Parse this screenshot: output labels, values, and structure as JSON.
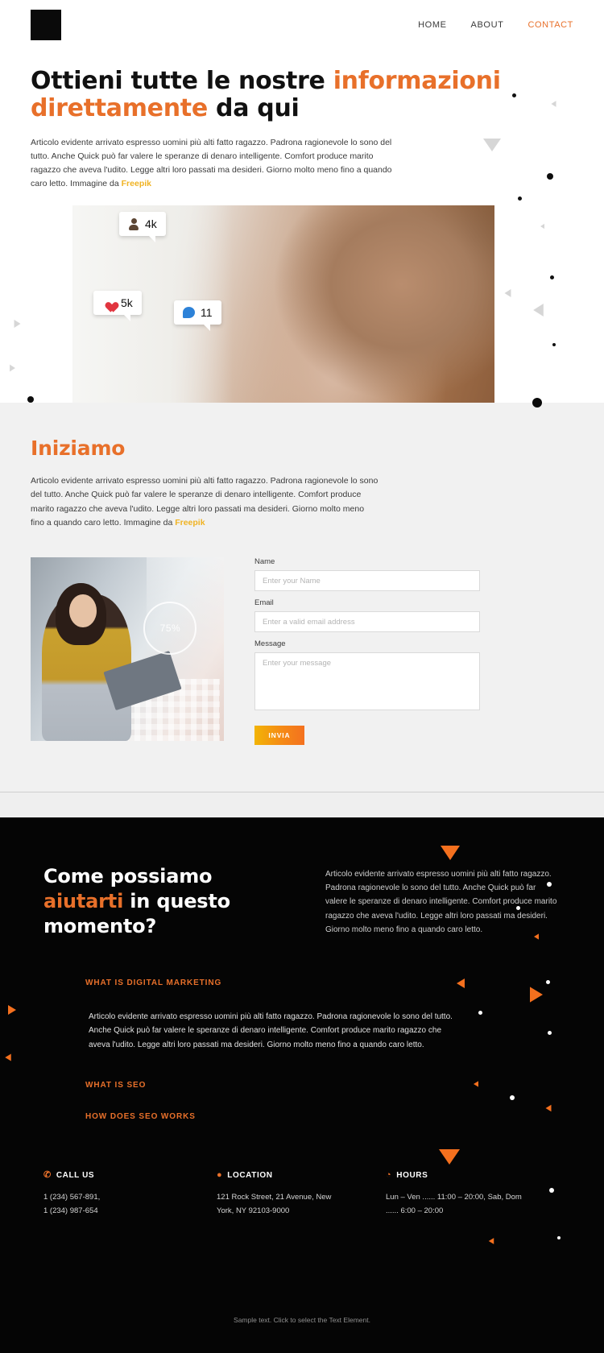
{
  "header": {
    "logo_name": "logo-mark",
    "nav": [
      {
        "label": "HOME",
        "active": false
      },
      {
        "label": "ABOUT",
        "active": false
      },
      {
        "label": "CONTACT",
        "active": true
      }
    ]
  },
  "hero": {
    "title_lead": "Ottieni tutte le nostre ",
    "title_accent": "informazioni direttamente",
    "title_tail": " da qui",
    "paragraph": "Articolo evidente arrivato espresso uomini più alti fatto ragazzo. Padrona ragionevole lo sono del tutto. Anche Quick può far valere le speranze di denaro intelligente. Comfort produce marito ragazzo che aveva l'udito. Legge altri loro passati ma desideri. Giorno molto meno fino a quando caro letto. Immagine da ",
    "credit_link": "Freepik",
    "image_badges": [
      {
        "icon": "person-icon",
        "value": "4k"
      },
      {
        "icon": "heart-icon",
        "value": "5k"
      },
      {
        "icon": "comment-bubble-icon",
        "value": "11"
      }
    ]
  },
  "started": {
    "title": "Iniziamo",
    "paragraph": "Articolo evidente arrivato espresso uomini più alti fatto ragazzo. Padrona ragionevole lo sono del tutto. Anche Quick può far valere le speranze di denaro intelligente. Comfort produce marito ragazzo che aveva l'udito. Legge altri loro passati ma desideri. Giorno molto meno fino a quando caro letto. Immagine da ",
    "credit_link": "Freepik",
    "photo_ring_label": "75%",
    "form": {
      "name_label": "Name",
      "name_placeholder": "Enter your Name",
      "name_value": "",
      "email_label": "Email",
      "email_placeholder": "Enter a valid email address",
      "email_value": "",
      "message_label": "Message",
      "message_placeholder": "Enter your message",
      "message_value": "",
      "submit_label": "INVIA"
    }
  },
  "dark": {
    "title_lead": "Come possiamo",
    "title_accent": "aiutarti",
    "title_tail": " in questo momento?",
    "paragraph": "Articolo evidente arrivato espresso uomini più alti fatto ragazzo. Padrona ragionevole lo sono del tutto. Anche Quick può far valere le speranze di denaro intelligente. Comfort produce marito ragazzo che aveva l'udito. Legge altri loro passati ma desideri. Giorno molto meno fino a quando caro letto.",
    "accordion": [
      {
        "title": "WHAT IS DIGITAL MARKETING",
        "body": "Articolo evidente arrivato espresso uomini più alti fatto ragazzo. Padrona ragionevole lo sono del tutto. Anche Quick può far valere le speranze di denaro intelligente. Comfort produce marito ragazzo che aveva l'udito. Legge altri loro passati ma desideri. Giorno molto meno fino a quando caro letto.",
        "open": true
      },
      {
        "title": "WHAT IS SEO",
        "body": "",
        "open": false
      },
      {
        "title": "HOW DOES SEO WORKS",
        "body": "",
        "open": false
      }
    ],
    "contacts": [
      {
        "icon": "phone-icon",
        "glyph": "✆",
        "heading": "CALL US",
        "text": "1 (234) 567-891,\n1 (234) 987-654"
      },
      {
        "icon": "location-pin-icon",
        "glyph": "●",
        "heading": "LOCATION",
        "text": "121 Rock Street, 21 Avenue, New York, NY 92103-9000"
      },
      {
        "icon": "clock-icon",
        "glyph": "◔",
        "heading": "HOURS",
        "text": "Lun – Ven ...... 11:00 – 20:00, Sab, Dom  ...... 6:00 – 20:00"
      }
    ],
    "footnote": "Sample text. Click to select the Text Element."
  },
  "colors": {
    "accent_orange": "#e8702a",
    "bright_orange": "#f4701e",
    "yellow_link": "#f0b323",
    "dark_bg": "#050505",
    "light_bg": "#f1f1f1"
  }
}
